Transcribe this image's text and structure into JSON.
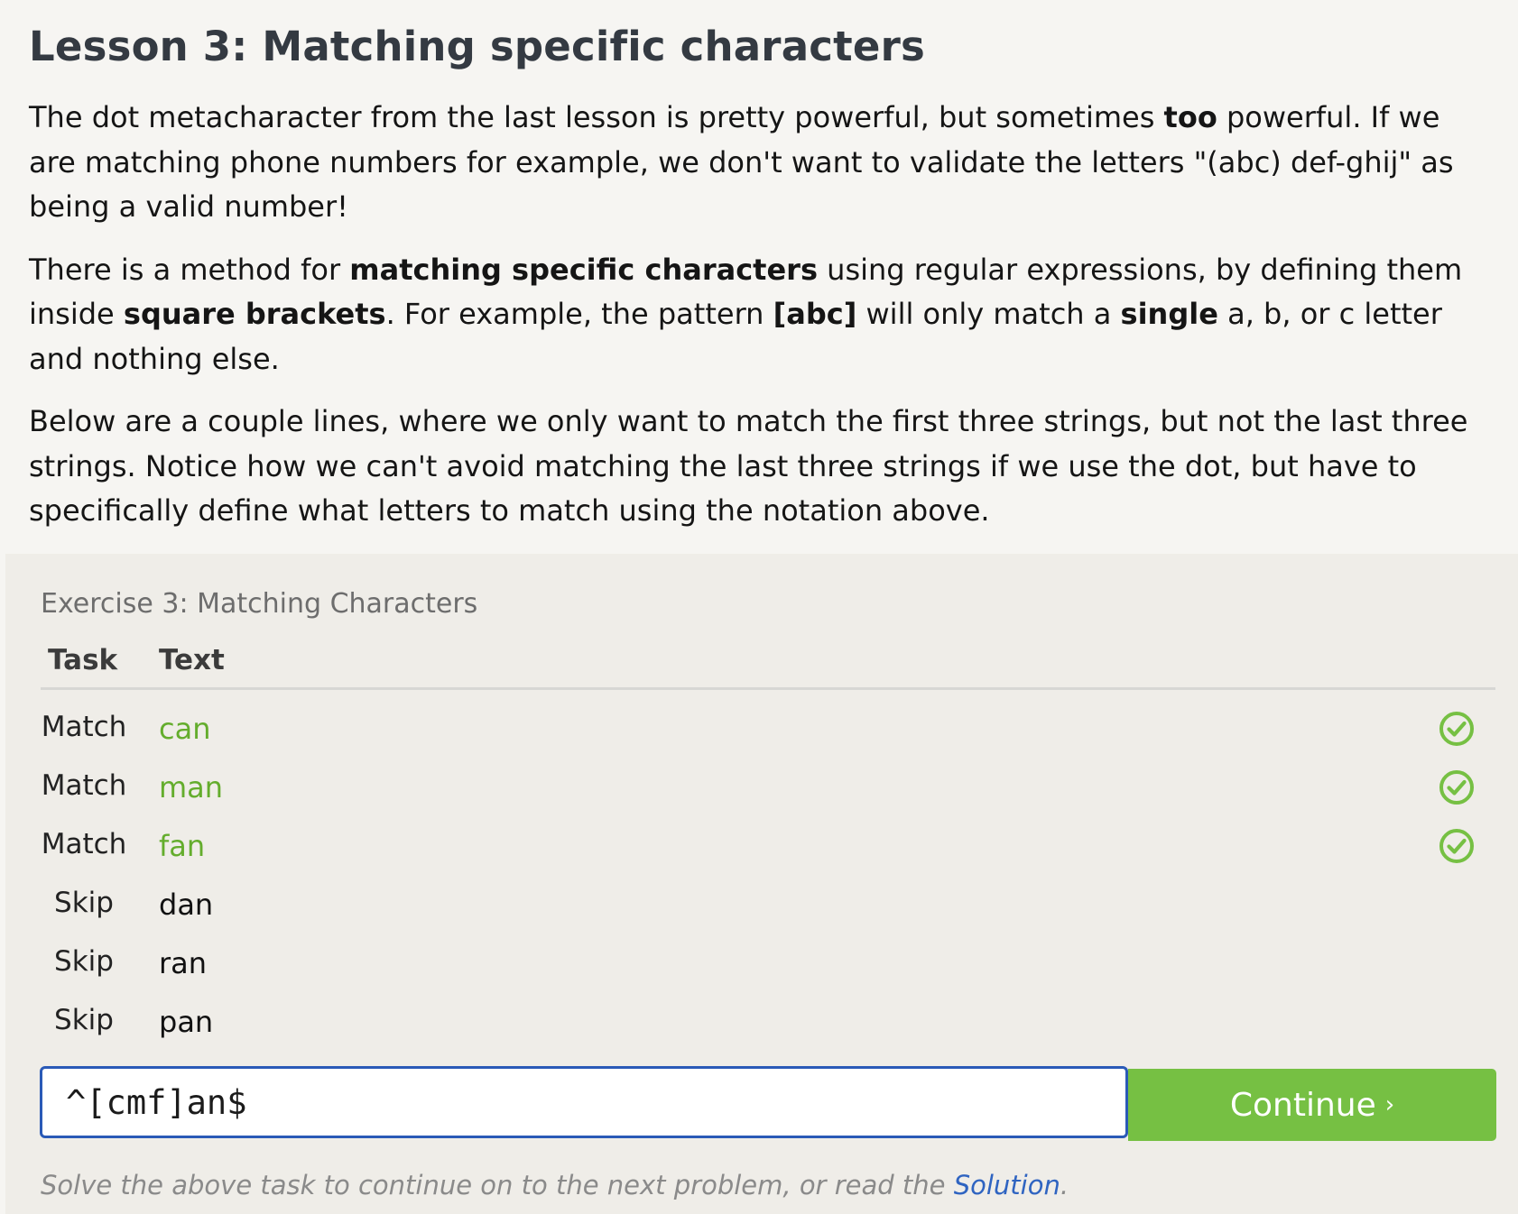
{
  "lesson": {
    "title": "Lesson 3: Matching specific characters",
    "p1": {
      "t1": "The dot metacharacter from the last lesson is pretty powerful, but sometimes ",
      "b1": "too",
      "t2": " powerful. If we are matching phone numbers for example, we don't want to validate the letters \"(abc) def-ghij\" as being a valid number!"
    },
    "p2": {
      "t1": "There is a method for ",
      "b1": "matching specific characters",
      "t2": " using regular expressions, by defining them inside ",
      "b2": "square brackets",
      "t3": ". For example, the pattern ",
      "b3": "[abc]",
      "t4": " will only match a ",
      "b4": "single",
      "t5": " a, b, or c letter and nothing else."
    },
    "p3": "Below are a couple lines, where we only want to match the first three strings, but not the last three strings. Notice how we can't avoid matching the last three strings if we use the dot, but have to specifically define what letters to match using the notation above."
  },
  "exercise": {
    "title": "Exercise 3: Matching Characters",
    "col_task": "Task",
    "col_text": "Text",
    "rows": [
      {
        "task": "Match",
        "text": "can",
        "status": "check-icon"
      },
      {
        "task": "Match",
        "text": "man",
        "status": "check-icon"
      },
      {
        "task": "Match",
        "text": "fan",
        "status": "check-icon"
      },
      {
        "task": "Skip",
        "text": "dan"
      },
      {
        "task": "Skip",
        "text": "ran"
      },
      {
        "task": "Skip",
        "text": "pan"
      }
    ],
    "input_value": "^[cmf]an$",
    "continue_label": "Continue",
    "continue_chevron": "›",
    "footnote_pre": "Solve the above task to continue on to the next problem, or read the ",
    "footnote_link": "Solution",
    "footnote_post": ".",
    "colors": {
      "match_text": "#64ad2d",
      "check": "#76c043",
      "button": "#76c043",
      "input_border": "#2a5ab7",
      "link": "#2f64c1"
    }
  }
}
